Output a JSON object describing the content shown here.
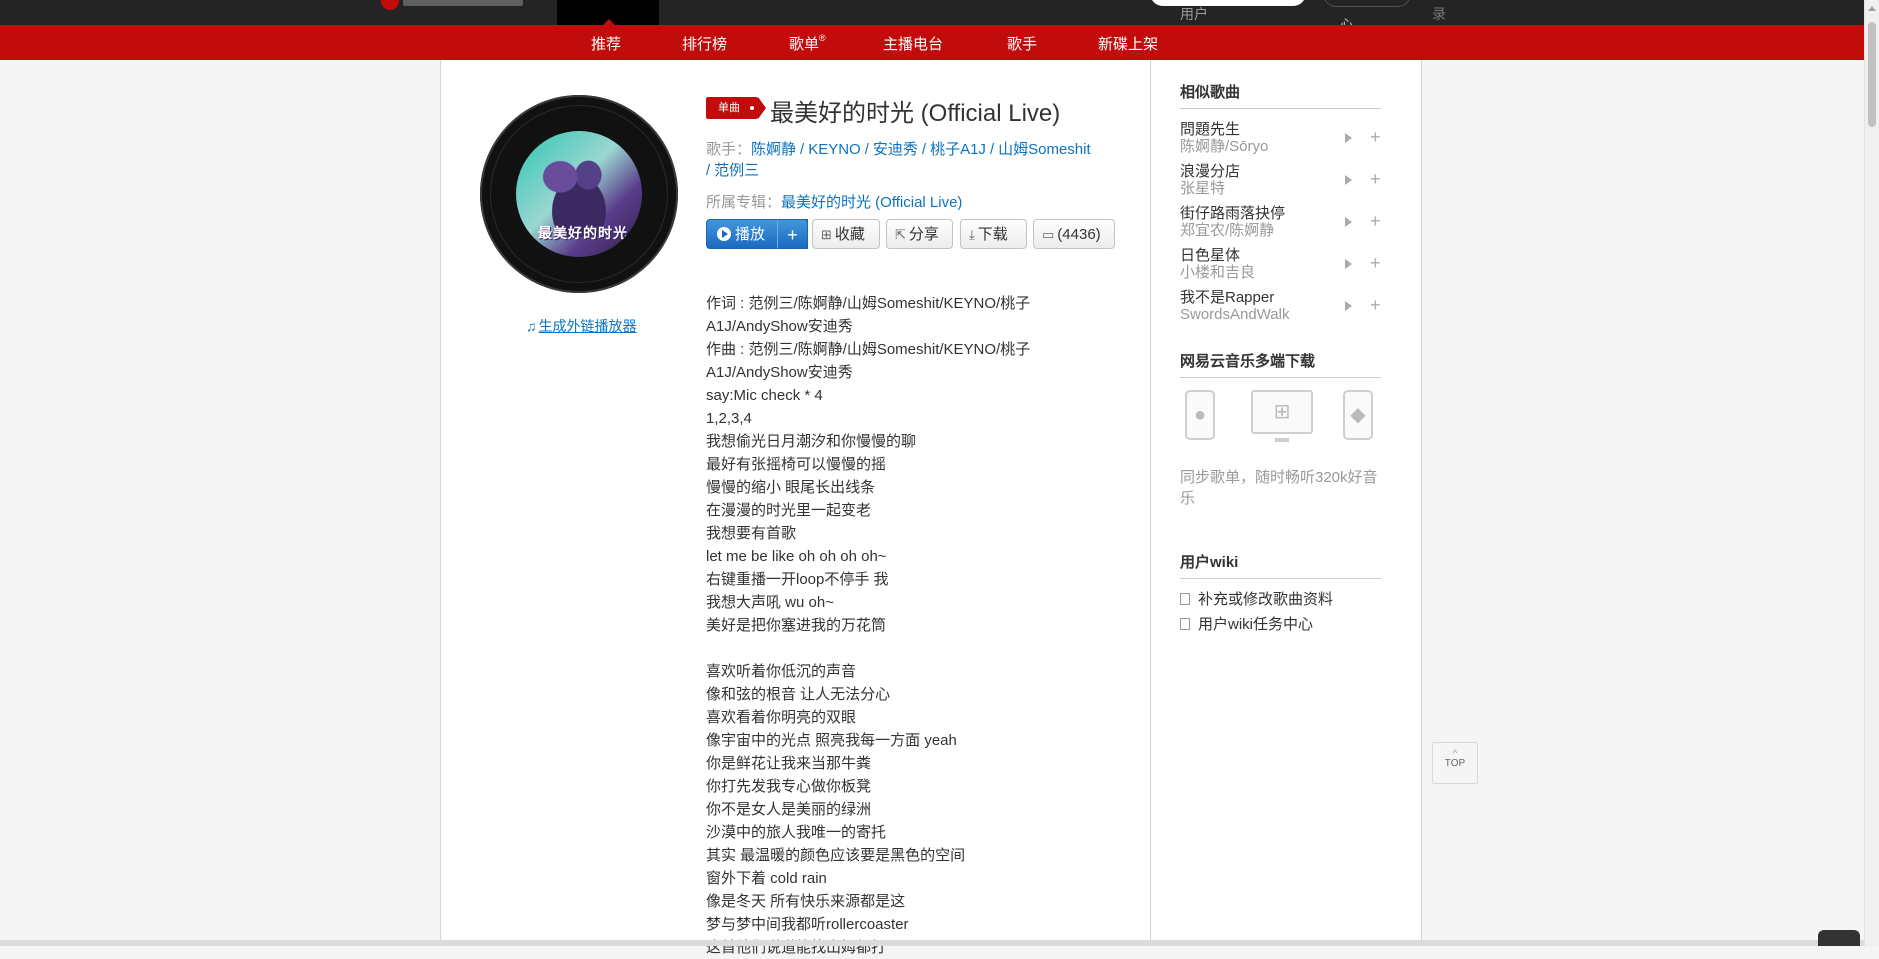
{
  "topbar": {
    "search_user": "用户",
    "creator_center": "心",
    "login": "录"
  },
  "subnav": [
    {
      "label": "推荐"
    },
    {
      "label": "排行榜"
    },
    {
      "label": "歌单",
      "sup": "®"
    },
    {
      "label": "主播电台"
    },
    {
      "label": "歌手"
    },
    {
      "label": "新碟上架"
    }
  ],
  "cover": {
    "art_title": "最美好的时光",
    "outchain_label": "生成外链播放器"
  },
  "song": {
    "badge": "单曲",
    "title": "最美好的时光 (Official Live)",
    "artists_label": "歌手：",
    "artists": [
      "陈婀静",
      "KEYNO",
      "安迪秀",
      "桃子A1J",
      "山姆Someshit",
      "范例三"
    ],
    "album_label": "所属专辑：",
    "album": "最美好的时光 (Official Live)"
  },
  "buttons": {
    "play": "播放",
    "add": "+",
    "favorite": "收藏",
    "share": "分享",
    "download": "下载",
    "comments": "(4436)"
  },
  "lyrics": [
    "作词 : 范例三/陈婀静/山姆Someshit/KEYNO/桃子",
    "A1J/AndyShow安迪秀",
    "作曲 : 范例三/陈婀静/山姆Someshit/KEYNO/桃子",
    "A1J/AndyShow安迪秀",
    "say:Mic check * 4",
    "1,2,3,4",
    "我想偷光日月潮汐和你慢慢的聊",
    "最好有张摇椅可以慢慢的摇",
    "慢慢的缩小 眼尾长出线条",
    "在漫漫的时光里一起变老",
    "我想要有首歌",
    "let me be like oh oh oh oh~",
    "右键重播一开loop不停手 我",
    "我想大声吼 wu oh~",
    "美好是把你塞进我的万花筒",
    "",
    "喜欢听着你低沉的声音",
    "像和弦的根音 让人无法分心",
    "喜欢看着你明亮的双眼",
    "像宇宙中的光点 照亮我每一方面 yeah",
    "你是鲜花让我来当那牛粪",
    "你打先发我专心做你板凳",
    "你不是女人是美丽的绿洲",
    "沙漠中的旅人我唯一的寄托",
    "其实 最温暖的颜色应该要是黑色的空间",
    "窗外下着 cold rain",
    "像是冬天 所有快乐来源都是这",
    "梦与梦中间我都听rollercoaster",
    "这首他们说道能找山姆都打"
  ],
  "sidebar": {
    "similar_title": "相似歌曲",
    "similar": [
      {
        "name": "問題先生",
        "artist": "陈婀静/Sōryo"
      },
      {
        "name": "浪漫分店",
        "artist": "张星特"
      },
      {
        "name": "街仔路雨落抉停",
        "artist": "郑宜农/陈婀静"
      },
      {
        "name": "日色星体",
        "artist": "小楼和吉良"
      },
      {
        "name": "我不是Rapper",
        "artist": "SwordsAndWalk"
      }
    ],
    "download_title": "网易云音乐多端下载",
    "download_desc": "同步歌单，随时畅听320k好音乐",
    "wiki_title": "用户wiki",
    "wiki_items": [
      "补充或修改歌曲资料",
      "用户wiki任务中心"
    ]
  },
  "totop": "TOP"
}
